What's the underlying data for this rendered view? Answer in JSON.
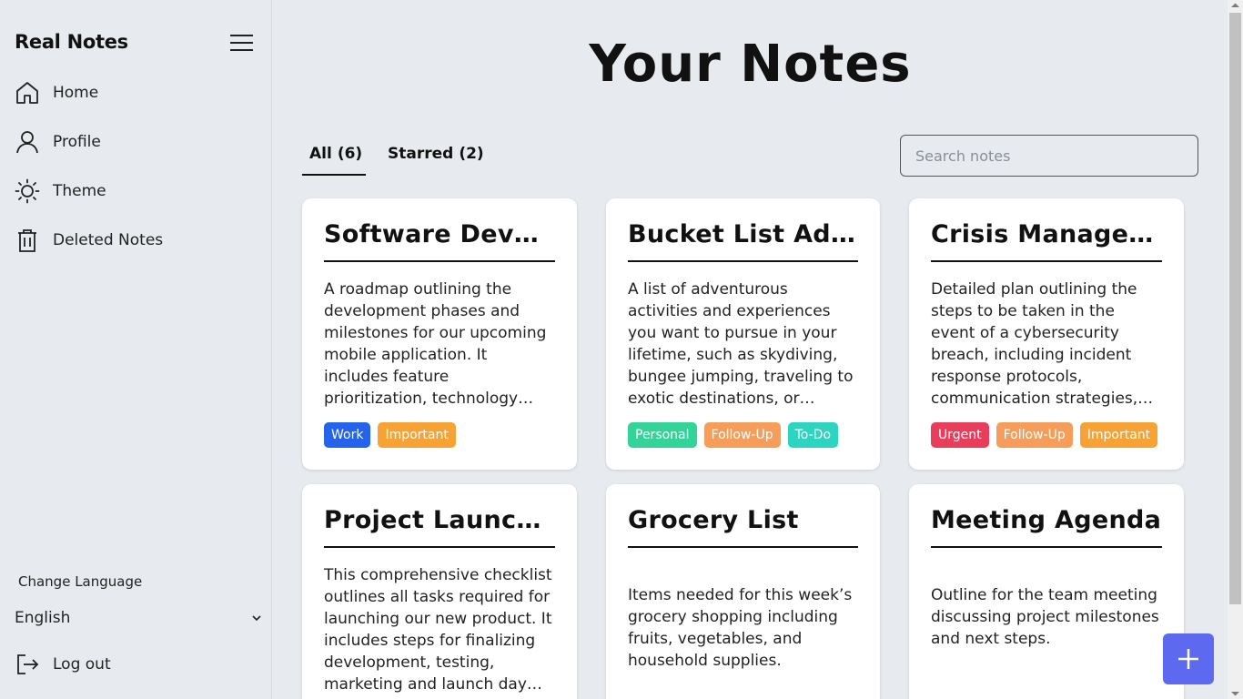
{
  "sidebar": {
    "brand": "Real Notes",
    "items": [
      {
        "label": "Home",
        "icon": "home-icon"
      },
      {
        "label": "Profile",
        "icon": "user-icon"
      },
      {
        "label": "Theme",
        "icon": "sun-icon"
      },
      {
        "label": "Deleted Notes",
        "icon": "trash-icon"
      }
    ],
    "change_language": "Change Language",
    "language": "English",
    "logout": "Log out"
  },
  "main": {
    "title": "Your Notes",
    "tabs": [
      {
        "label": "All",
        "count": "(6)",
        "active": true
      },
      {
        "label": "Starred",
        "count": "(2)",
        "active": false
      }
    ],
    "search": {
      "placeholder": "Search notes",
      "value": ""
    },
    "notes": [
      {
        "title": "Software Development Roadmap",
        "body": "A roadmap outlining the development phases and milestones for our upcoming mobile application. It includes feature prioritization, technology stack decisions, and release timelines.",
        "tags": [
          {
            "label": "Work",
            "color": "#2563eb"
          },
          {
            "label": "Important",
            "color": "#f7a234"
          }
        ]
      },
      {
        "title": "Bucket List Adventures",
        "body": "A list of adventurous activities and experiences you want to pursue in your lifetime, such as skydiving, bungee jumping, traveling to exotic destinations, or learning new skills.",
        "tags": [
          {
            "label": "Personal",
            "color": "#34d399"
          },
          {
            "label": "Follow-Up",
            "color": "#f59e5b"
          },
          {
            "label": "To-Do",
            "color": "#2dd4bf"
          }
        ]
      },
      {
        "title": "Crisis Management Plan",
        "body": "Detailed plan outlining the steps to be taken in the event of a cybersecurity breach, including incident response protocols, communication strategies, and recovery procedures.",
        "tags": [
          {
            "label": "Urgent",
            "color": "#e83e5c"
          },
          {
            "label": "Follow-Up",
            "color": "#f59e5b"
          },
          {
            "label": "Important",
            "color": "#f7a234"
          }
        ]
      },
      {
        "title": "Project Launch Checklist",
        "body": "This comprehensive checklist outlines all tasks required for launching our new product. It includes steps for finalizing development, testing, marketing and launch day coordination.",
        "tags": []
      },
      {
        "title": "Grocery List",
        "body": "Items needed for this week’s grocery shopping including fruits, vegetables, and household supplies.",
        "tags": []
      },
      {
        "title": "Meeting Agenda",
        "body": "Outline for the team meeting discussing project milestones and next steps.",
        "tags": []
      }
    ]
  },
  "fab": {
    "icon": "plus-icon",
    "color": "#5d6af0"
  }
}
